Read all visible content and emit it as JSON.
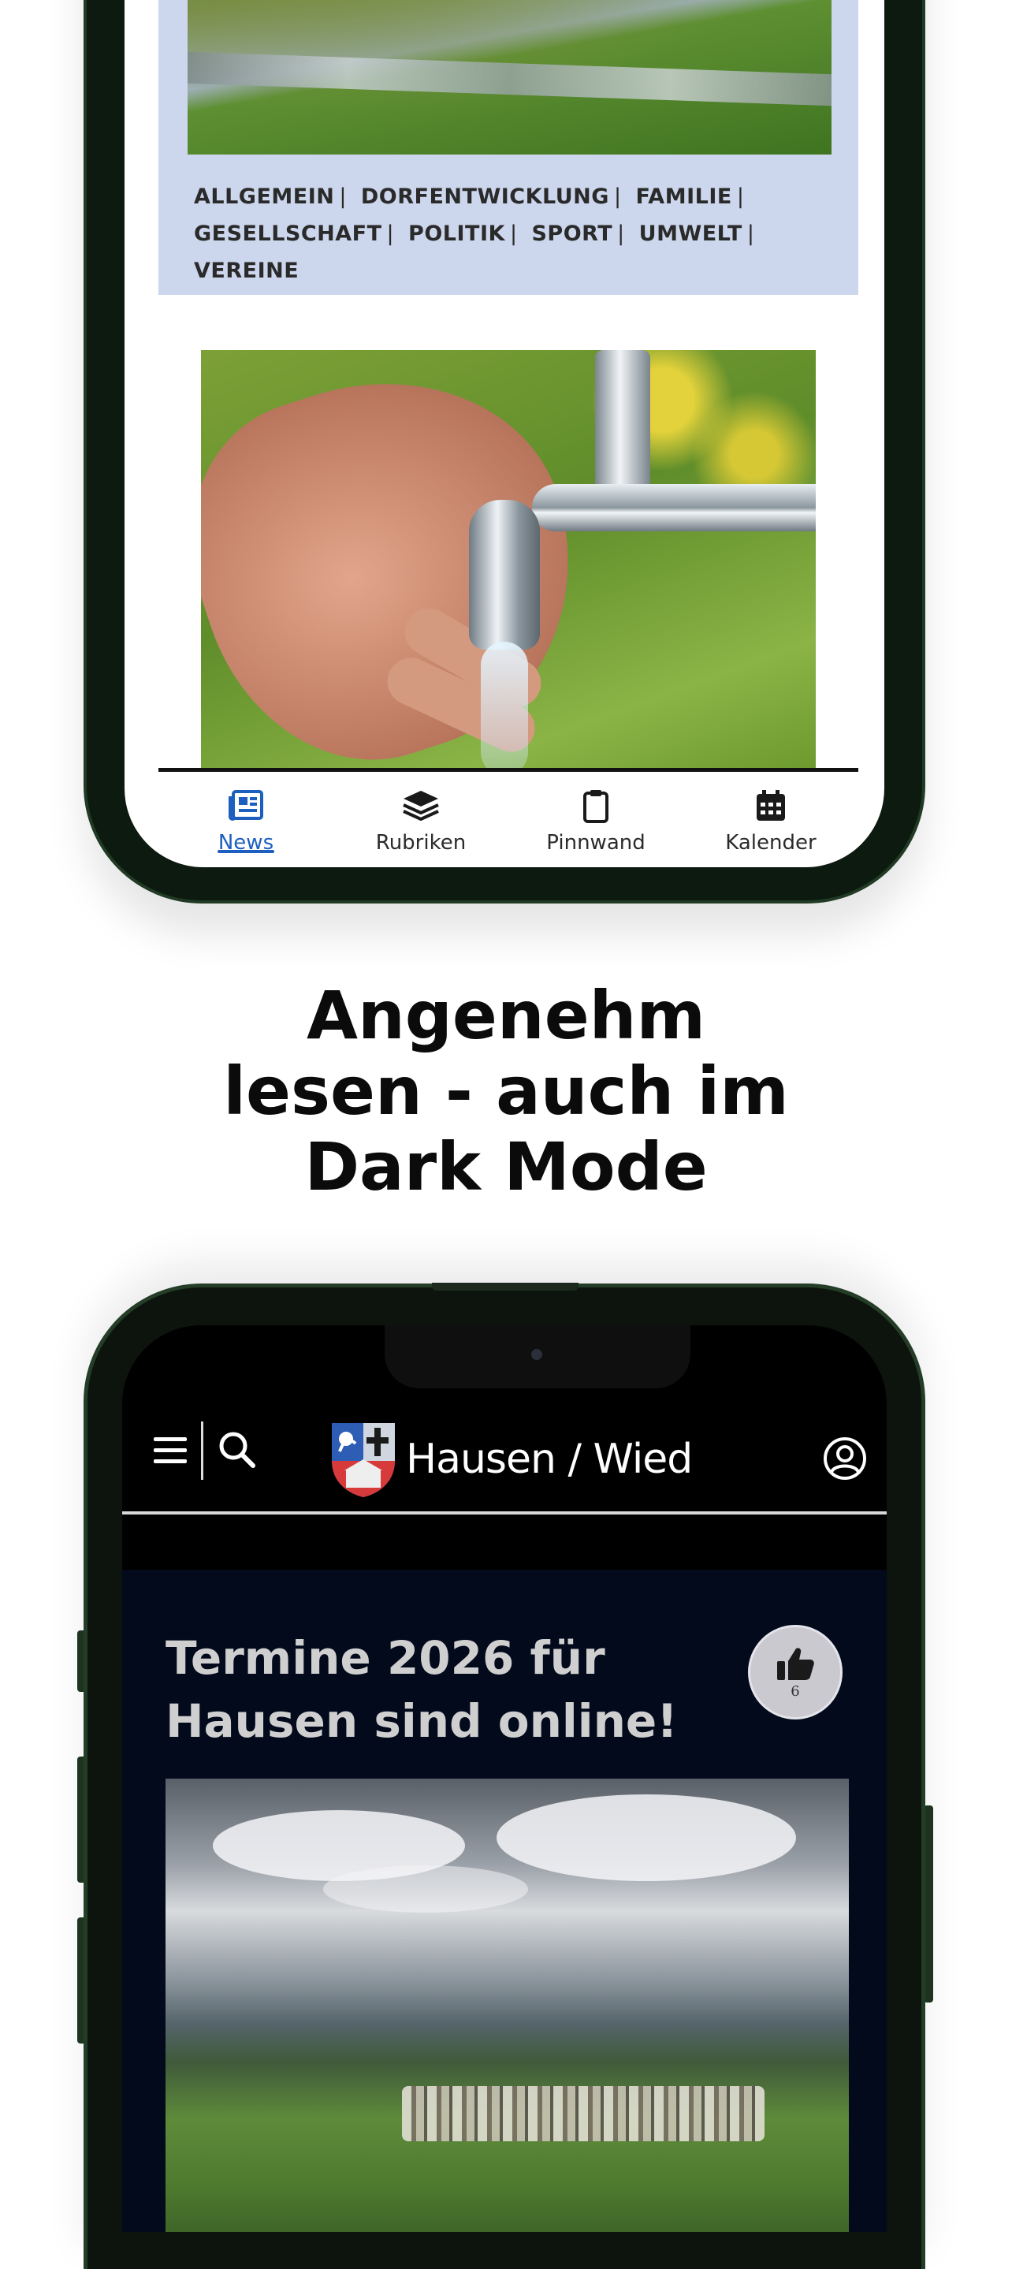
{
  "phone_light": {
    "tags": [
      "ALLGEMEIN",
      "DORFENTWICKLUNG",
      "FAMILIE",
      "GESELLSCHAFT",
      "POLITIK",
      "SPORT",
      "UMWELT",
      "VEREINE"
    ],
    "tabbar": {
      "news": "News",
      "rubriken": "Rubriken",
      "pinnwand": "Pinnwand",
      "kalender": "Kalender",
      "active": "News"
    }
  },
  "headline": {
    "line1": "Angenehm",
    "line2": "lesen - auch im",
    "line3": "Dark Mode"
  },
  "phone_dark": {
    "app_title": "Hausen / Wied",
    "article": {
      "title_line1": "Termine 2026 für",
      "title_line2": "Hausen sind online!",
      "like_count": "6"
    }
  },
  "colors": {
    "accent": "#1d5fbf",
    "card_light": "#ccd6ec",
    "dark_article_bg": "#020a1c",
    "phone_frame": "#203a24"
  },
  "icons": [
    "newspaper-icon",
    "layers-icon",
    "clipboard-icon",
    "calendar-icon",
    "menu-icon",
    "search-icon",
    "coat-of-arms-logo",
    "account-icon",
    "thumbs-up-icon"
  ]
}
